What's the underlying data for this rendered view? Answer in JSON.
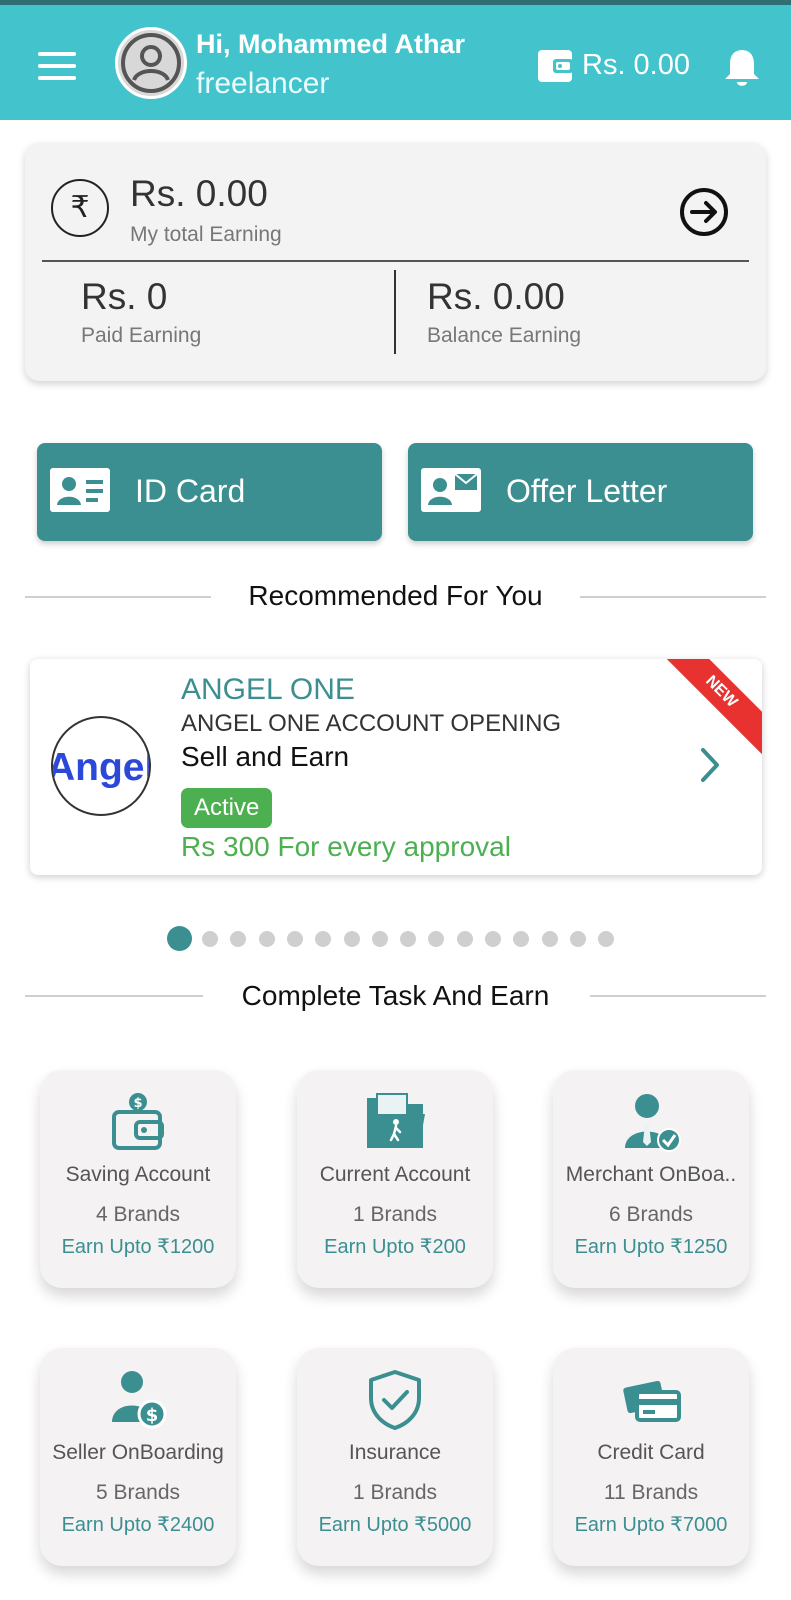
{
  "header": {
    "greeting": "Hi, Mohammed Athar",
    "role": "freelancer",
    "wallet_amount": "Rs. 0.00"
  },
  "earnings": {
    "total_amount": "Rs. 0.00",
    "total_label": "My total Earning",
    "paid_amount": "Rs. 0",
    "paid_label": "Paid Earning",
    "balance_amount": "Rs. 0.00",
    "balance_label": "Balance Earning"
  },
  "actions": {
    "id_card": "ID Card",
    "offer_letter": "Offer Letter"
  },
  "recommended": {
    "title": "Recommended For You",
    "card": {
      "logo_text": "Angel",
      "brand": "ANGEL ONE",
      "subtitle": "ANGEL ONE ACCOUNT OPENING",
      "title": "Sell and Earn",
      "status": "Active",
      "reward": "Rs 300 For every approval",
      "ribbon": "NEW"
    },
    "carousel": {
      "total": 16,
      "active_index": 0
    }
  },
  "tasks": {
    "title": "Complete Task And Earn",
    "items": [
      {
        "name": "Saving Account",
        "brands": "4 Brands",
        "earn": "Earn Upto ₹1200",
        "icon": "wallet-icon"
      },
      {
        "name": "Current Account",
        "brands": "1 Brands",
        "earn": "Earn Upto ₹200",
        "icon": "folder-icon"
      },
      {
        "name": "Merchant OnBoa..",
        "brands": "6 Brands",
        "earn": "Earn Upto ₹1250",
        "icon": "merchant-icon"
      },
      {
        "name": "Seller OnBoarding",
        "brands": "5 Brands",
        "earn": "Earn Upto ₹2400",
        "icon": "seller-icon"
      },
      {
        "name": "Insurance",
        "brands": "1 Brands",
        "earn": "Earn Upto ₹5000",
        "icon": "shield-icon"
      },
      {
        "name": "Credit Card",
        "brands": "11 Brands",
        "earn": "Earn Upto ₹7000",
        "icon": "credit-card-icon"
      }
    ]
  },
  "colors": {
    "header": "#43c3cc",
    "accent": "#3b8f91",
    "success": "#4caf50",
    "ribbon": "#e73230"
  }
}
